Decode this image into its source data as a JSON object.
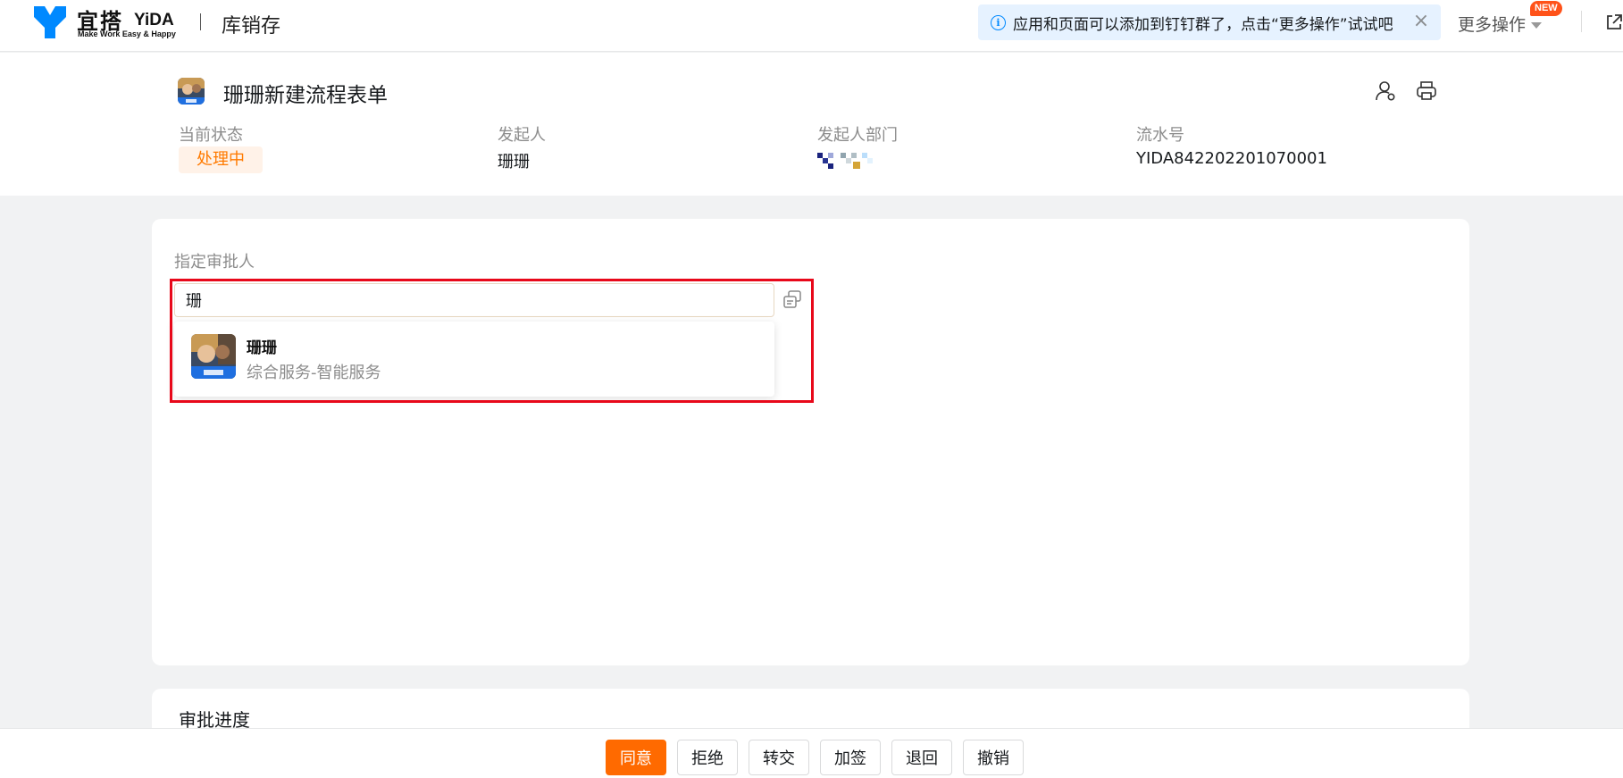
{
  "topbar": {
    "logo_cn": "宜搭",
    "logo_en": "YiDA",
    "logo_slogan": "Make Work Easy & Happy",
    "app_name": "库销存",
    "notice_text": "应用和页面可以添加到钉钉群了，点击“更多操作”试试吧",
    "more_actions_label": "更多操作",
    "new_badge": "NEW"
  },
  "header": {
    "form_title": "珊珊新建流程表单",
    "status_label": "当前状态",
    "status_value": "处理中",
    "initiator_label": "发起人",
    "initiator_value": "珊珊",
    "department_label": "发起人部门",
    "serial_label": "流水号",
    "serial_value": "YIDA842202201070001"
  },
  "approver": {
    "field_label": "指定审批人",
    "input_value": "珊",
    "options": [
      {
        "name": "珊珊",
        "department": "综合服务-智能服务"
      }
    ]
  },
  "progress": {
    "title": "审批进度"
  },
  "actions": {
    "agree": "同意",
    "reject": "拒绝",
    "transfer": "转交",
    "add_sign": "加签",
    "return": "退回",
    "revoke": "撤销"
  },
  "colors": {
    "primary": "#ff6a00",
    "status_text": "#ff7a00",
    "status_bg": "#fff2e8",
    "highlight": "#e8081a",
    "notice_bg": "#e6f2ff",
    "logo_blue": "#0089ff"
  }
}
